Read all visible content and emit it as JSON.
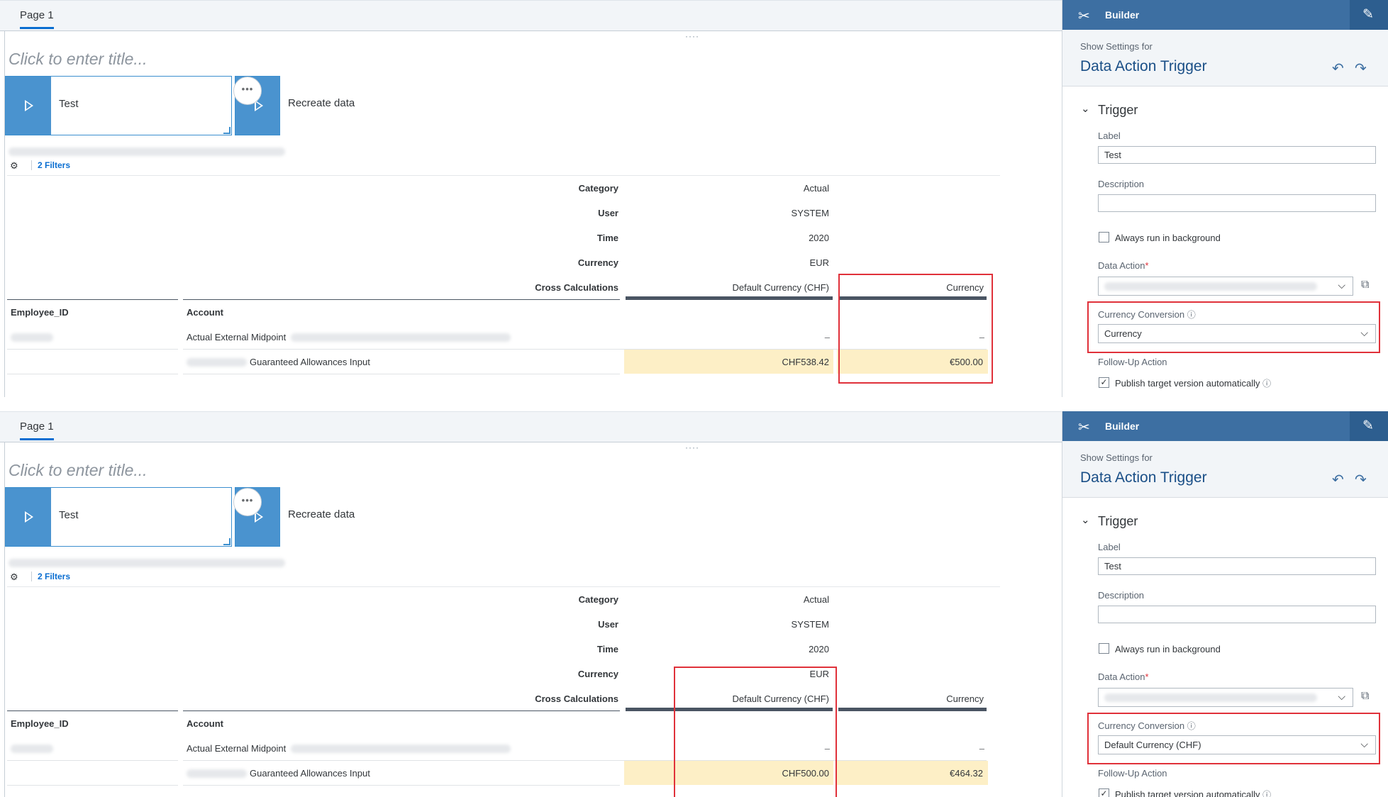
{
  "panels": [
    {
      "story": {
        "page_tab": "Page 1",
        "title_placeholder": "Click to enter title...",
        "trigger_button_label": "Test",
        "second_button_label": "Recreate data",
        "more_label": "•••",
        "filters_label": "2 Filters",
        "header_labels": [
          "Category",
          "User",
          "Time",
          "Currency",
          "Cross Calculations"
        ],
        "header_values": [
          "Actual",
          "SYSTEM",
          "2020",
          "EUR",
          "Default Currency (CHF)"
        ],
        "extra_column_header": "Currency",
        "row_headers": [
          "Employee_ID",
          "Account"
        ],
        "rows": [
          {
            "account": "Actual External Midpoint",
            "col1": "–",
            "col2": "–"
          },
          {
            "account": "Guaranteed Allowances Input",
            "col1": "CHF538.42",
            "col2": "€500.00"
          }
        ]
      },
      "builder": {
        "header_title": "Builder",
        "show_settings_for": "Show Settings for",
        "object_title": "Data Action Trigger",
        "section": "Trigger",
        "label_label": "Label",
        "label_value": "Test",
        "description_label": "Description",
        "description_value": "",
        "always_background": "Always run in background",
        "data_action_label": "Data Action",
        "required_marker": "*",
        "currency_conversion_label": "Currency Conversion",
        "currency_conversion_value": "Currency",
        "follow_up_label": "Follow-Up Action",
        "publish_label": "Publish target version automatically"
      }
    },
    {
      "story": {
        "page_tab": "Page 1",
        "title_placeholder": "Click to enter title...",
        "trigger_button_label": "Test",
        "second_button_label": "Recreate data",
        "more_label": "•••",
        "filters_label": "2 Filters",
        "header_labels": [
          "Category",
          "User",
          "Time",
          "Currency",
          "Cross Calculations"
        ],
        "header_values": [
          "Actual",
          "SYSTEM",
          "2020",
          "EUR",
          "Default Currency (CHF)"
        ],
        "extra_column_header": "Currency",
        "row_headers": [
          "Employee_ID",
          "Account"
        ],
        "rows": [
          {
            "account": "Actual External Midpoint",
            "col1": "–",
            "col2": "–"
          },
          {
            "account": "Guaranteed Allowances Input",
            "col1": "CHF500.00",
            "col2": "€464.32"
          }
        ]
      },
      "builder": {
        "header_title": "Builder",
        "show_settings_for": "Show Settings for",
        "object_title": "Data Action Trigger",
        "section": "Trigger",
        "label_label": "Label",
        "label_value": "Test",
        "description_label": "Description",
        "description_value": "",
        "always_background": "Always run in background",
        "data_action_label": "Data Action",
        "required_marker": "*",
        "currency_conversion_label": "Currency Conversion",
        "currency_conversion_value": "Default Currency (CHF)",
        "follow_up_label": "Follow-Up Action",
        "publish_label": "Publish target version automatically"
      }
    }
  ],
  "colors": {
    "accent": "#0a6ed1",
    "builder_header": "#3d6fa2",
    "button_blue": "#4a93cf",
    "highlight_cell": "#fdefc6",
    "annotation_red": "#e0313a"
  },
  "icons": [
    "play-icon",
    "more-icon",
    "filter-icon",
    "tools-icon",
    "pin-icon",
    "undo-icon",
    "redo-icon",
    "chevron-down-icon",
    "info-icon",
    "external-link-icon",
    "checkbox-icon"
  ]
}
